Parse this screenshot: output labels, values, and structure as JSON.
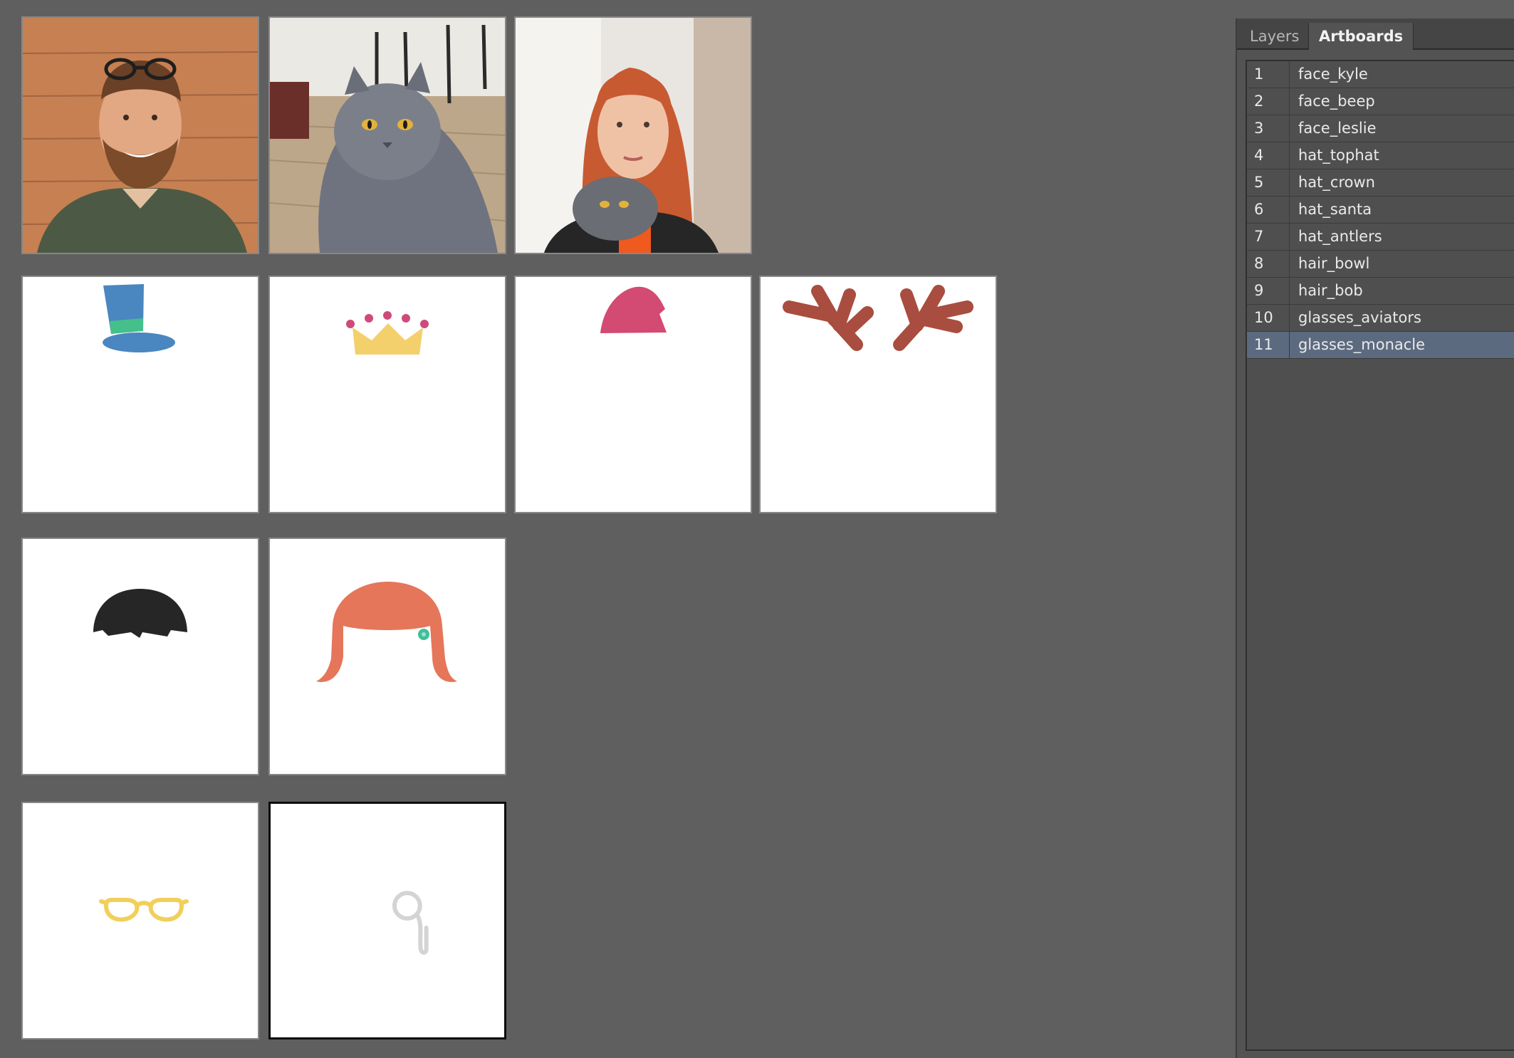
{
  "panel": {
    "tabs": [
      {
        "label": "Layers",
        "active": false
      },
      {
        "label": "Artboards",
        "active": true
      }
    ],
    "artboards": [
      {
        "index": "1",
        "name": "face_kyle"
      },
      {
        "index": "2",
        "name": "face_beep"
      },
      {
        "index": "3",
        "name": "face_leslie"
      },
      {
        "index": "4",
        "name": "hat_tophat"
      },
      {
        "index": "5",
        "name": "hat_crown"
      },
      {
        "index": "6",
        "name": "hat_santa"
      },
      {
        "index": "7",
        "name": "hat_antlers"
      },
      {
        "index": "8",
        "name": "hair_bowl"
      },
      {
        "index": "9",
        "name": "hair_bob"
      },
      {
        "index": "10",
        "name": "glasses_aviators"
      },
      {
        "index": "11",
        "name": "glasses_monacle"
      }
    ],
    "selected_index": "11"
  },
  "colors": {
    "workspace": "#5f5f5f",
    "tophat": "#4a86c0",
    "tophat_band": "#45c08a",
    "crown": "#f3d06b",
    "crown_jewels": "#cf4a7b",
    "santa": "#d34a72",
    "antlers": "#a84d3f",
    "bowl": "#262626",
    "bob": "#e5765a",
    "clip": "#3fbf9a",
    "aviators": "#f1cf5a",
    "monacle": "#d4d4d4"
  }
}
